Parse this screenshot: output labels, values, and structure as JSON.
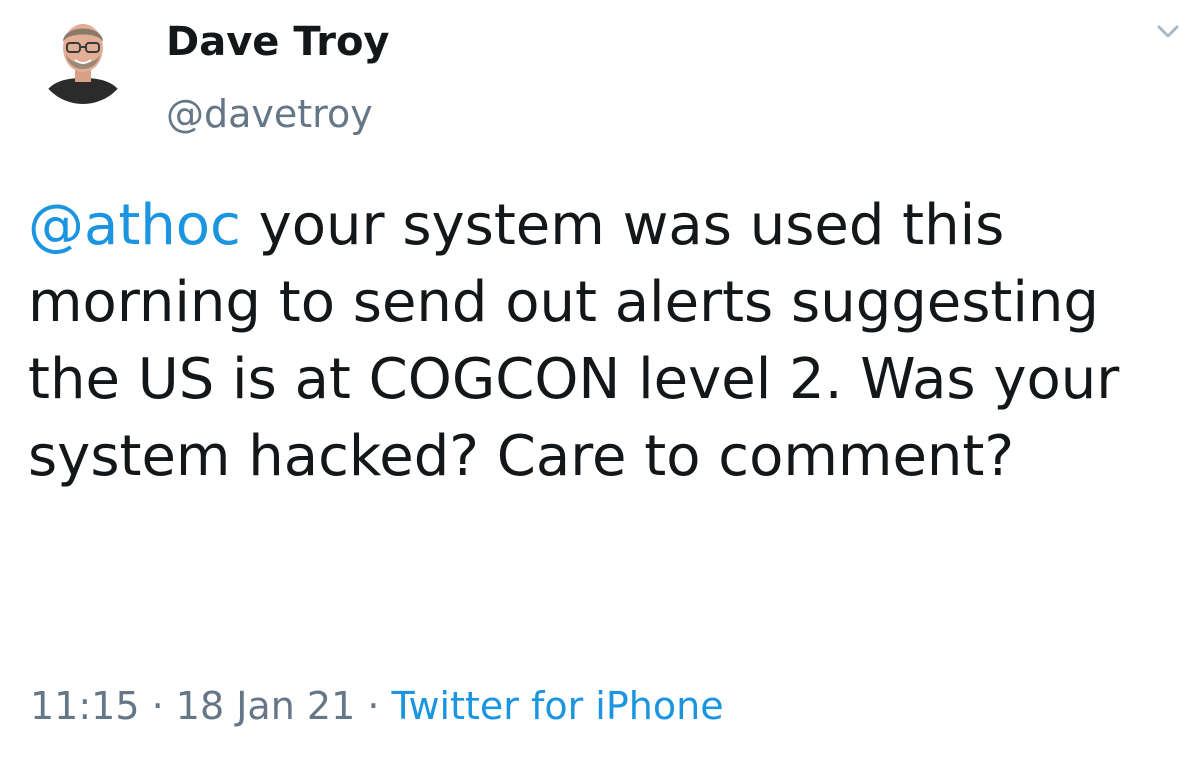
{
  "author": {
    "name": "Dave Troy",
    "handle": "@davetroy"
  },
  "tweet": {
    "mention": "@athoc",
    "text": " your system was used this morning to send out alerts suggesting the US is at COGCON level 2. Was your system hacked? Care to comment?"
  },
  "meta": {
    "time": "11:15",
    "separator": "·",
    "date": "18 Jan 21",
    "source": "Twitter for iPhone"
  },
  "icons": {
    "menu": "chevron-down-icon"
  },
  "colors": {
    "link": "#1b95e0",
    "secondary_text": "#657786",
    "primary_text": "#14171a"
  }
}
